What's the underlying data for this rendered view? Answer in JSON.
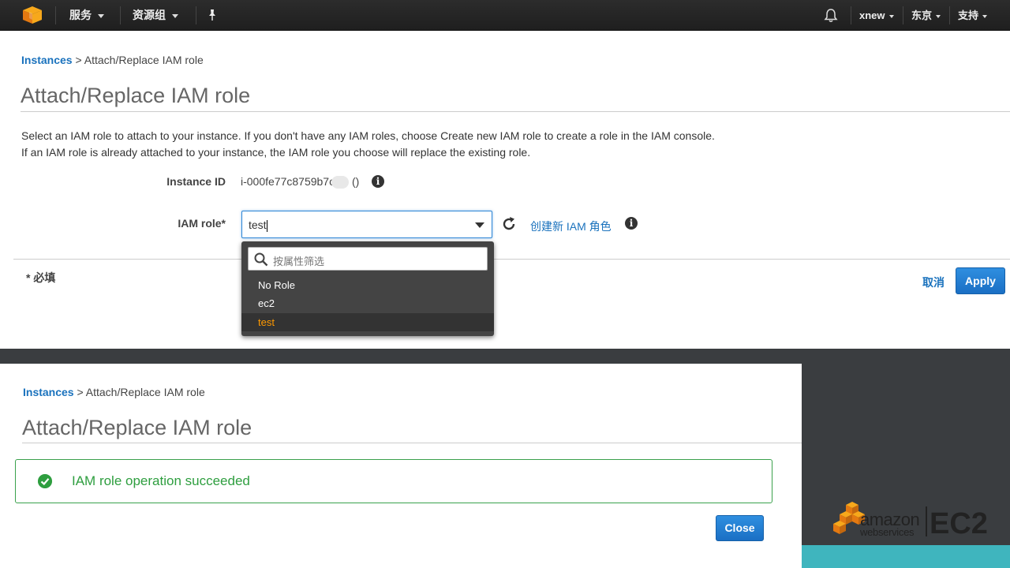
{
  "topnav": {
    "services": "服务",
    "resource_groups": "资源组",
    "user": "xnew",
    "region": "东京",
    "support": "支持"
  },
  "dialog": {
    "breadcrumb_link": "Instances",
    "breadcrumb_current": " > Attach/Replace IAM role",
    "title": "Attach/Replace IAM role",
    "desc_line1": "Select an IAM role to attach to your instance. If you don't have any IAM roles, choose Create new IAM role to create a role in the IAM console.",
    "desc_line2": "If an IAM role is already attached to your instance, the IAM role you choose will replace the existing role.",
    "instance_id_label": "Instance ID",
    "instance_id_value": "i-000fe77c8759b7c",
    "instance_id_suffix": " ()",
    "iam_role_label": "IAM role*",
    "iam_role_value": "test",
    "create_role_link": "创建新 IAM 角色",
    "filter_placeholder": "按属性筛选",
    "options": [
      "No Role",
      "ec2",
      "test"
    ],
    "selected_option": "test",
    "required_note": "* 必填",
    "cancel_label": "取消",
    "apply_label": "Apply"
  },
  "result": {
    "breadcrumb_link": "Instances",
    "breadcrumb_current": " > Attach/Replace IAM role",
    "title": "Attach/Replace IAM role",
    "success_message": "IAM role operation succeeded",
    "close_label": "Close"
  },
  "brand": {
    "amazon": "amazon",
    "webservices": "webservices",
    "ec2": "EC2"
  },
  "colors": {
    "link": "#1a72bd",
    "success": "#2e9e3f",
    "selected_option": "#ff9900",
    "nav_bg": "#232323"
  }
}
